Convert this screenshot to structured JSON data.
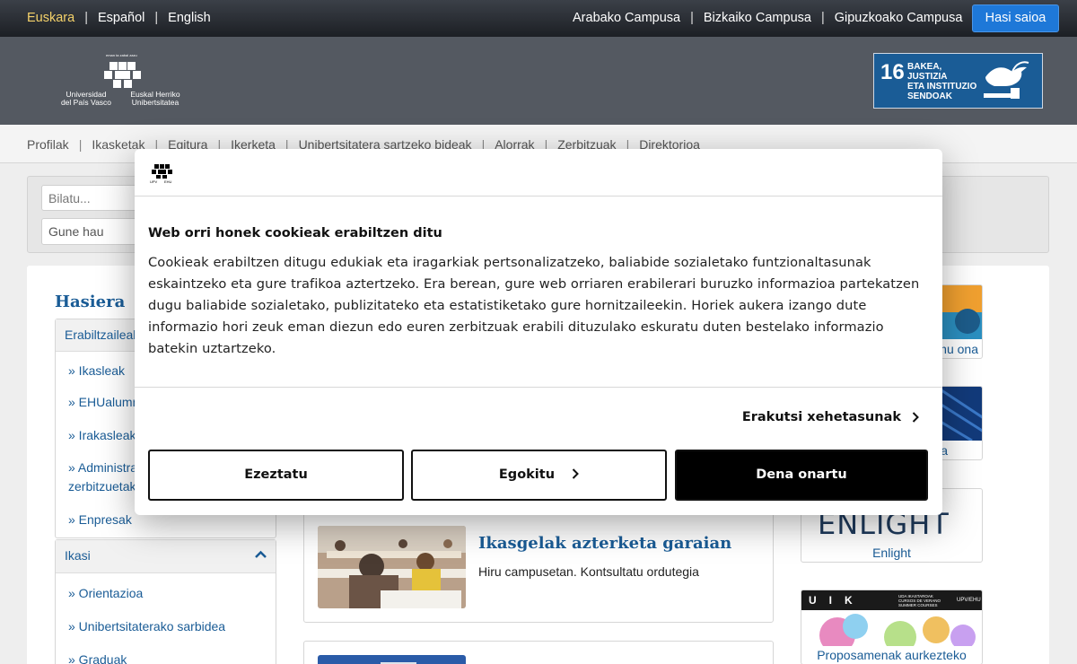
{
  "topbar": {
    "languages": [
      "Euskara",
      "Español",
      "English"
    ],
    "campuses": [
      "Arabako Campusa",
      "Bizkaiko Campusa",
      "Gipuzkoako Campusa"
    ],
    "login": "Hasi saioa"
  },
  "header": {
    "logo_motto": "eman ta zabal zazu",
    "logo_left": [
      "Universidad",
      "del País Vasco"
    ],
    "logo_right": [
      "Euskal Herriko",
      "Unibertsitatea"
    ],
    "sdg_number": "16",
    "sdg_text": [
      "BAKEA, JUSTIZIA",
      "ETA INSTITUZIO",
      "SENDOAK"
    ]
  },
  "nav": {
    "items": [
      "Profilak",
      "Ikasketak",
      "Egitura",
      "Ikerketa",
      "Unibertsitatera sartzeko bideak",
      "Alorrak",
      "Zerbitzuak",
      "Direktorioa"
    ]
  },
  "search": {
    "placeholder": "Bilatu...",
    "scope": "Gune hau"
  },
  "sidebar": {
    "title": "Hasiera",
    "group1": {
      "label": "Erabiltzaileak",
      "links": [
        "» Ikasleak",
        "» EHUalumni",
        "» Irakasleak",
        "» Administrazio eta",
        "zerbitzuetako",
        "» Enpresak"
      ]
    },
    "group2": {
      "label": "Ikasi",
      "links": [
        "» Orientazioa",
        "» Unibertsitaterako sarbidea",
        "» Graduak"
      ]
    }
  },
  "cards": [
    {
      "title": "Ikasgelak azterketa garaian",
      "desc": "Hiru campusetan. Kontsultatu ordutegia"
    }
  ],
  "right_cards": [
    "mu ona",
    "a",
    "Enlight",
    "Proposamenak aurkezteko"
  ],
  "right_logo_text": "ENLIGHT",
  "uik_text": [
    "U",
    "I",
    "K",
    "UDA IKASTAROAK",
    "CURSOS DE VERANO",
    "SUMMER COURSES",
    "UPV/EHU"
  ],
  "modal": {
    "logo_caption": [
      "UPV",
      "EHU"
    ],
    "title": "Web orri honek cookieak erabiltzen ditu",
    "body": "Cookieak erabiltzen ditugu edukiak eta iragarkiak pertsonalizatzeko, baliabide sozialetako funtzionaltasunak eskaintzeko eta gure trafikoa aztertzeko. Era berean, gure web orriaren erabilerari buruzko informazioa partekatzen dugu baliabide sozialetako, publizitateko eta estatistiketako gure hornitzaileekin. Horiek aukera izango dute informazio hori zeuk eman diezun edo euren zerbitzuak erabili dituzulako eskuratu duten bestelako informazio batekin uztartzeko.",
    "details": "Erakutsi xehetasunak",
    "reject": "Ezeztatu",
    "customize": "Egokitu",
    "accept": "Dena onartu"
  },
  "colors": {
    "accent": "#1a5c96",
    "login": "#1e78d8",
    "header": "#545961",
    "active_lang": "#f5d26a"
  }
}
